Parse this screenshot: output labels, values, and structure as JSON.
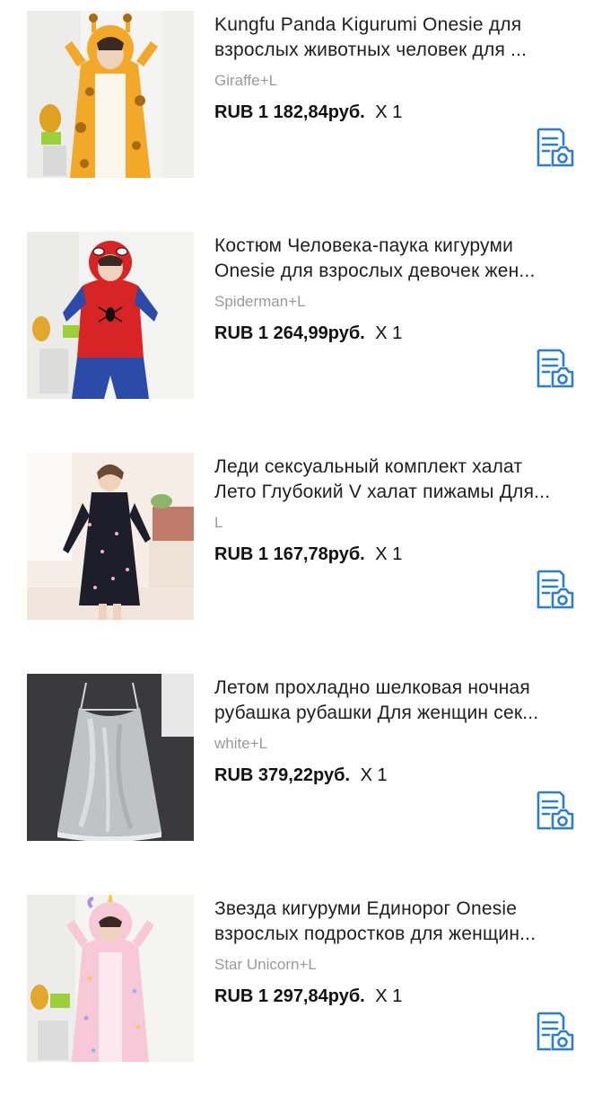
{
  "accent_color": "#2b7ed6",
  "items": [
    {
      "title_line1": "Kungfu Panda Kigurumi Onesie для",
      "title_line2": "взрослых животных человек для ...",
      "variant": "Giraffe+L",
      "price": "RUB 1 182,84руб.",
      "qty": "X 1",
      "thumb_icon": "giraffe-onesie-photo",
      "review_icon": "photo-review-icon"
    },
    {
      "title_line1": "Костюм Человека-паука кигуруми",
      "title_line2": "Onesie для взрослых девочек жен...",
      "variant": "Spiderman+L",
      "price": "RUB 1 264,99руб.",
      "qty": "X 1",
      "thumb_icon": "spiderman-onesie-photo",
      "review_icon": "photo-review-icon"
    },
    {
      "title_line1": "Леди сексуальный комплект халат",
      "title_line2": "Лето Глубокий V халат пижамы Для...",
      "variant": "L",
      "price": "RUB 1 167,78руб.",
      "qty": "X 1",
      "thumb_icon": "robe-set-photo",
      "review_icon": "photo-review-icon"
    },
    {
      "title_line1": "Летом прохладно шелковая ночная",
      "title_line2": "рубашка рубашки Для женщин сек...",
      "variant": "white+L",
      "price": "RUB 379,22руб.",
      "qty": "X 1",
      "thumb_icon": "silk-nightgown-photo",
      "review_icon": "photo-review-icon"
    },
    {
      "title_line1": "Звезда кигуруми Единорог Onesie",
      "title_line2": "взрослых подростков для женщин...",
      "variant": "Star Unicorn+L",
      "price": "RUB 1 297,84руб.",
      "qty": "X 1",
      "thumb_icon": "unicorn-onesie-photo",
      "review_icon": "photo-review-icon"
    }
  ]
}
